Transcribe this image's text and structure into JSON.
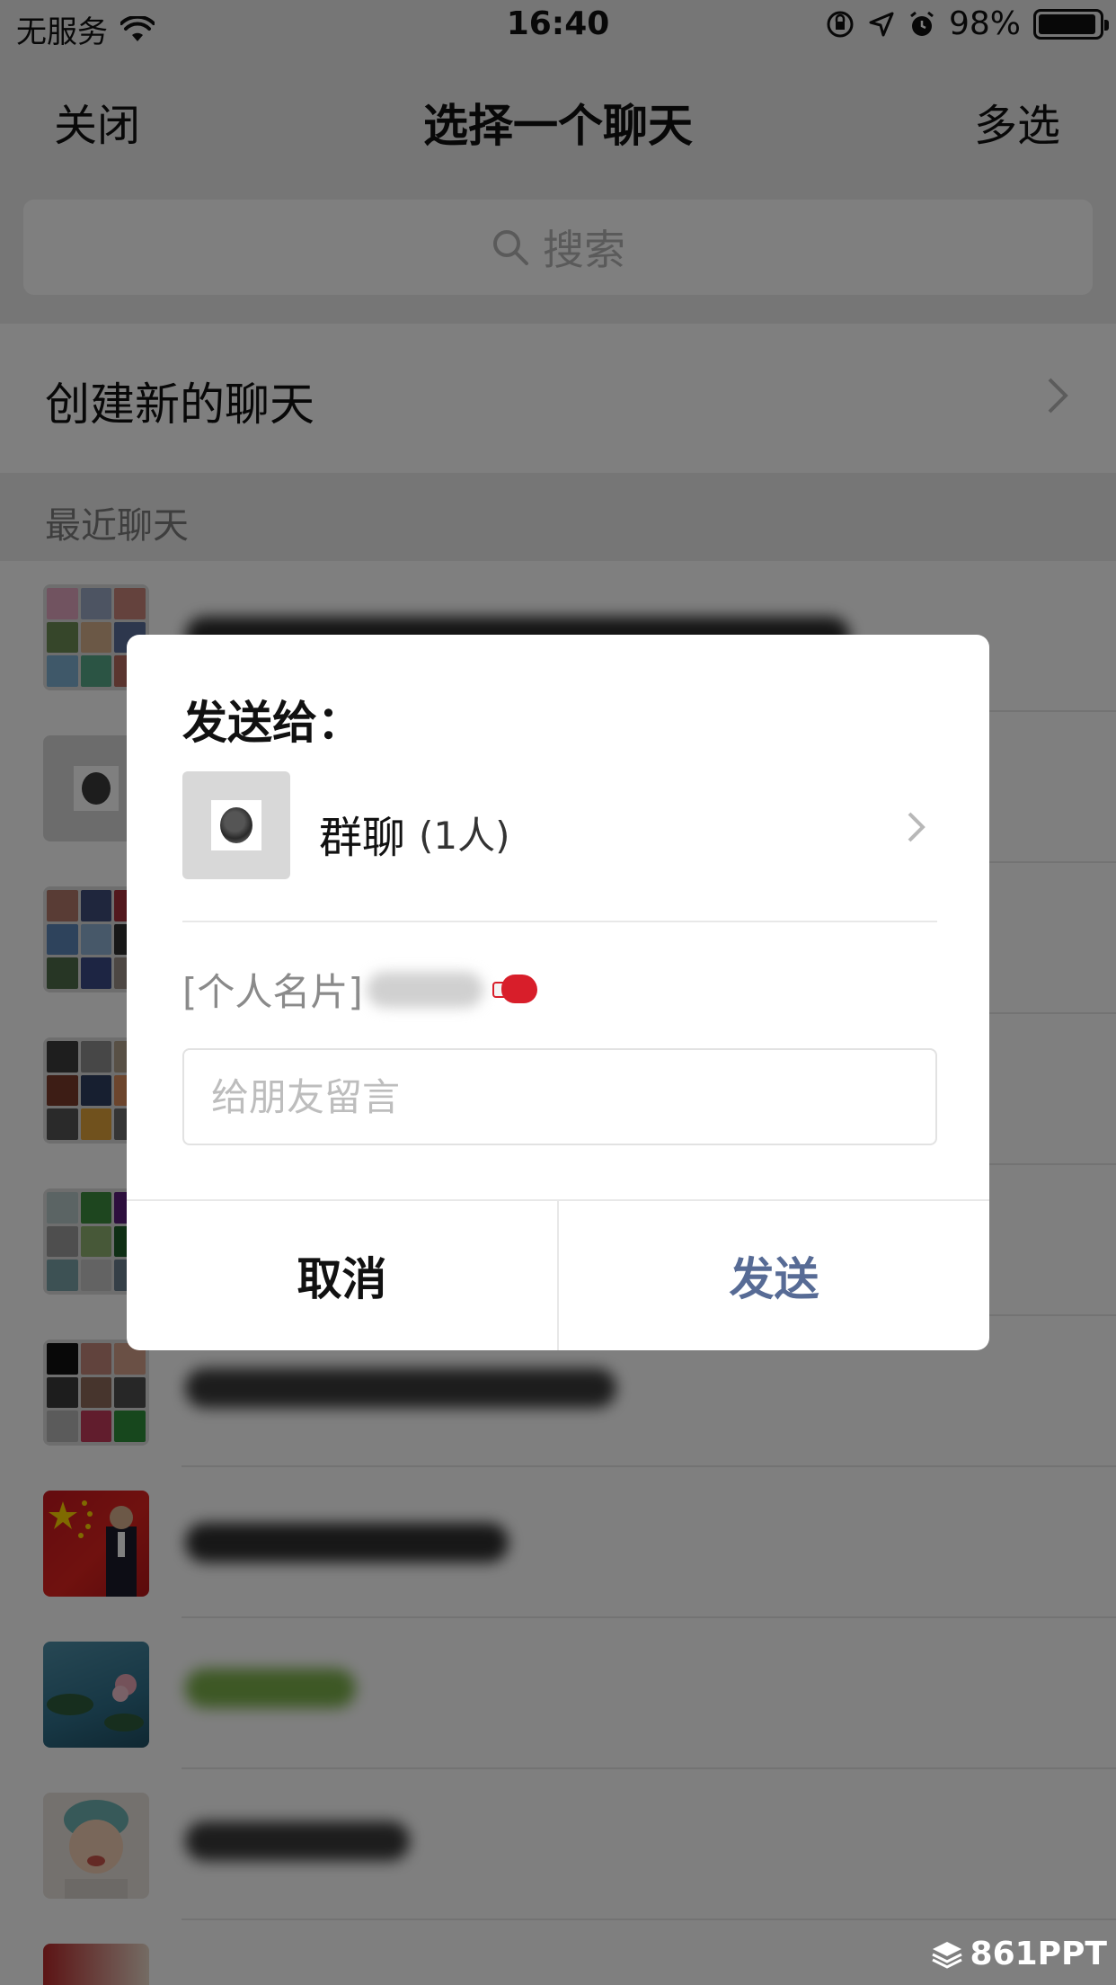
{
  "status_bar": {
    "carrier": "无服务",
    "time": "16:40",
    "battery": "98%"
  },
  "nav": {
    "close": "关闭",
    "title": "选择一个聊天",
    "multi_select": "多选"
  },
  "search": {
    "placeholder": "搜索"
  },
  "create_chat": {
    "label": "创建新的聊天"
  },
  "recent_header": "最近聊天",
  "dialog": {
    "title": "发送给：",
    "recipient_name": "群聊",
    "recipient_count": "(1人)",
    "card_prefix": "[个人名片]",
    "message_placeholder": "给朋友留言",
    "cancel": "取消",
    "send": "发送"
  },
  "colors": {
    "send_button": "#576b95",
    "overlay": "rgba(0,0,0,0.5)"
  },
  "watermark": "861PPT"
}
